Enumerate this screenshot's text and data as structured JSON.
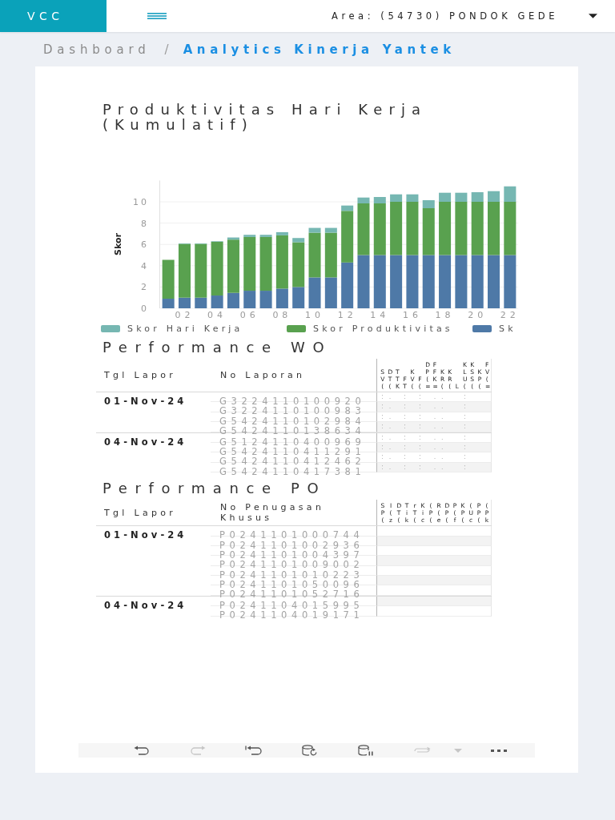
{
  "header": {
    "brand": "VCC",
    "area": "Area: (54730) PONDOK GEDE"
  },
  "breadcrumb": {
    "separator": "/",
    "items": [
      {
        "label": "Dashboard",
        "active": false
      },
      {
        "label": "Analytics Kinerja Yantek",
        "active": true
      }
    ]
  },
  "chart": {
    "chart_data": {
      "type": "bar",
      "title": "Produktivitas Hari Kerja (Kumulatif)",
      "ylabel": "Skor",
      "grid": true,
      "legend": "bottom",
      "x": [
        1,
        2,
        3,
        4,
        5,
        6,
        7,
        8,
        9,
        10,
        11,
        12,
        13,
        14,
        15,
        16,
        17,
        18,
        19,
        20,
        21,
        22
      ],
      "series": [
        {
          "name": "Skor Hari Kerja",
          "color": "#76b7b2",
          "values": [
            0,
            0.05,
            0.05,
            0.05,
            0.2,
            0.2,
            0.2,
            0.3,
            0.4,
            0.45,
            0.45,
            0.5,
            0.55,
            0.6,
            0.7,
            0.7,
            0.75,
            0.85,
            0.85,
            0.9,
            1.0,
            1.45
          ]
        },
        {
          "name": "Skor Produktivitas",
          "color": "#59a14f",
          "values": [
            3.65,
            5.05,
            5.05,
            5.05,
            5.0,
            5.05,
            5.05,
            5.0,
            4.2,
            4.2,
            4.2,
            4.85,
            4.85,
            4.85,
            5,
            5,
            4.4,
            5,
            5,
            5,
            5,
            5
          ]
        },
        {
          "name": "Sk",
          "color": "#4e79a7",
          "values": [
            0.9,
            1.0,
            1.0,
            1.2,
            1.45,
            1.65,
            1.65,
            1.85,
            2.0,
            2.9,
            2.9,
            4.3,
            5,
            5,
            5,
            5,
            5,
            5,
            5,
            5,
            5,
            5
          ]
        }
      ],
      "stacked": true,
      "xlim": [
        0.5,
        22.5
      ],
      "ylim": [
        0,
        12
      ],
      "xticks": [
        {
          "value": 2,
          "label": "02"
        },
        {
          "value": 4,
          "label": "04"
        },
        {
          "value": 6,
          "label": "06"
        },
        {
          "value": 8,
          "label": "08"
        },
        {
          "value": 10,
          "label": "10"
        },
        {
          "value": 12,
          "label": "12"
        },
        {
          "value": 14,
          "label": "14"
        },
        {
          "value": 16,
          "label": "16"
        },
        {
          "value": 18,
          "label": "18"
        },
        {
          "value": 20,
          "label": "20"
        },
        {
          "value": 22,
          "label": "22"
        }
      ],
      "yticks": [
        0,
        2,
        4,
        6,
        8,
        10
      ]
    }
  },
  "tables": [
    {
      "title": "Performance WO",
      "columns": [
        {
          "label": "Tgl Lapor"
        },
        {
          "label": "No Laporan"
        }
      ],
      "narrow_columns": [
        {
          "header": "SV("
        },
        {
          "header": "DT("
        },
        {
          "header": "TTK"
        },
        {
          "header": "FT"
        },
        {
          "header": "KV("
        },
        {
          "header": "F("
        },
        {
          "header": "DP(="
        },
        {
          "header": "FFK="
        },
        {
          "header": "KR("
        },
        {
          "header": "KR("
        },
        {
          "header": "L"
        },
        {
          "header": "KLU("
        },
        {
          "header": "KSS("
        },
        {
          "header": "KP("
        },
        {
          "header": "FV(="
        }
      ],
      "groups": [
        {
          "date": "01-Nov-24",
          "rows": [
            {
              "number": "G3224110100920",
              "column_3": ":",
              "column_4": ".",
              "column_6": ":",
              "column_8": ":",
              "column_10": ".",
              "column_11": ".",
              "column_14": ":"
            },
            {
              "number": "G3224110100983",
              "column_3": ":",
              "column_4": ".",
              "column_6": ":",
              "column_8": ":",
              "column_10": ".",
              "column_11": ".",
              "column_14": ":"
            },
            {
              "number": "G5424110102984",
              "column_3": ":",
              "column_4": ".",
              "column_6": ":",
              "column_8": ":",
              "column_10": ".",
              "column_11": ".",
              "column_14": ":"
            },
            {
              "number": "G5424110138634",
              "column_3": ":",
              "column_4": ".",
              "column_6": ":",
              "column_8": ":",
              "column_10": ".",
              "column_11": ".",
              "column_14": ":"
            }
          ]
        },
        {
          "date": "04-Nov-24",
          "rows": [
            {
              "number": "G5124110400969",
              "column_3": ":",
              "column_4": ".",
              "column_6": ":",
              "column_8": ":",
              "column_10": ".",
              "column_11": ".",
              "column_14": ":"
            },
            {
              "number": "G5424110411291",
              "column_3": ":",
              "column_4": ".",
              "column_6": ":",
              "column_8": ":",
              "column_10": ".",
              "column_11": ".",
              "column_14": ":"
            },
            {
              "number": "G5424110412462",
              "column_3": ":",
              "column_4": ".",
              "column_6": ":",
              "column_8": ":",
              "column_10": ".",
              "column_11": ".",
              "column_14": ":"
            },
            {
              "number": "G5424110417381",
              "column_3": ":",
              "column_4": ".",
              "column_6": ":",
              "column_8": ":",
              "column_10": ".",
              "column_11": ".",
              "column_14": ":"
            }
          ]
        }
      ]
    },
    {
      "title": "Performance PO",
      "columns": [
        {
          "label": "Tgl Lapor"
        },
        {
          "label": "No Penugasan Khusus"
        }
      ],
      "narrow_columns": [
        {
          "header": "SP("
        },
        {
          "header": "I(z"
        },
        {
          "header": "DT("
        },
        {
          "header": "Tik"
        },
        {
          "header": "rT("
        },
        {
          "header": "Kic"
        },
        {
          "header": "(P("
        },
        {
          "header": "R(e"
        },
        {
          "header": "DP("
        },
        {
          "header": "P(f"
        },
        {
          "header": "KP("
        },
        {
          "header": "(Uc"
        },
        {
          "header": "PP("
        },
        {
          "header": "(Pk"
        }
      ],
      "groups": [
        {
          "date": "01-Nov-24",
          "rows": [
            {
              "number": "P0241101000744"
            },
            {
              "number": "P0241101002936"
            },
            {
              "number": "P0241101004397"
            },
            {
              "number": "P0241101009002"
            },
            {
              "number": "P0241101010223"
            },
            {
              "number": "P0241101050096"
            },
            {
              "number": "P0241101052716"
            }
          ]
        },
        {
          "date": "04-Nov-24",
          "rows": [
            {
              "number": "P0241104015995"
            },
            {
              "number": "P0241104019171"
            }
          ]
        }
      ]
    }
  ],
  "toolbar": [
    {
      "kind": "undo",
      "disabled": false
    },
    {
      "kind": "redo",
      "disabled": true
    },
    {
      "kind": "revert",
      "disabled": false
    },
    {
      "kind": "refresh",
      "disabled": false
    },
    {
      "kind": "pause",
      "disabled": false
    },
    {
      "kind": "share",
      "disabled": true
    },
    {
      "kind": "dropdown",
      "disabled": true
    },
    {
      "kind": "more",
      "disabled": false
    }
  ]
}
